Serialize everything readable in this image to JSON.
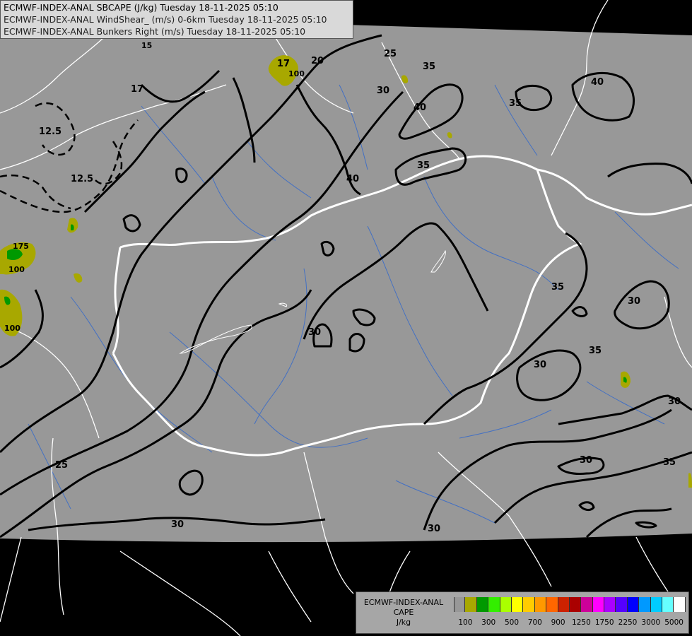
{
  "header": {
    "line1": "ECMWF-INDEX-ANAL SBCAPE (J/kg) Tuesday 18-11-2025 05:10",
    "line2": "ECMWF-INDEX-ANAL WindShear_ (m/s) 0-6km Tuesday 18-11-2025 05:10",
    "line3": "ECMWF-INDEX-ANAL Bunkers Right (m/s) Tuesday 18-11-2025 05:10"
  },
  "legend": {
    "title": "ECMWF-INDEX-ANAL",
    "variable": "CAPE",
    "unit": "J/kg",
    "colors": [
      "#989898",
      "#a8a800",
      "#009900",
      "#33ee00",
      "#aaff00",
      "#ffff00",
      "#ffcc00",
      "#ff9900",
      "#ff6600",
      "#cc2200",
      "#aa0000",
      "#cc0099",
      "#ff00ff",
      "#aa00ff",
      "#5500ff",
      "#0000ff",
      "#0099ff",
      "#00ccff",
      "#66ffff",
      "#ffffff"
    ],
    "tick_labels": [
      "100",
      "300",
      "500",
      "700",
      "900",
      "1250",
      "1750",
      "2250",
      "3000",
      "5000"
    ]
  },
  "contour_labels": [
    {
      "id": "l1",
      "text": "17"
    },
    {
      "id": "l2",
      "text": "17"
    },
    {
      "id": "l3",
      "text": "20"
    },
    {
      "id": "l4",
      "text": "25"
    },
    {
      "id": "l5",
      "text": "30"
    },
    {
      "id": "l6",
      "text": "35"
    },
    {
      "id": "l7",
      "text": "40"
    },
    {
      "id": "l8",
      "text": "40"
    },
    {
      "id": "l9",
      "text": "35"
    },
    {
      "id": "l10",
      "text": "12.5"
    },
    {
      "id": "l11",
      "text": "12.5"
    },
    {
      "id": "l12",
      "text": "40"
    },
    {
      "id": "l13",
      "text": "35"
    },
    {
      "id": "l14",
      "text": "35"
    },
    {
      "id": "l15",
      "text": "30"
    },
    {
      "id": "l16",
      "text": "30"
    },
    {
      "id": "l17",
      "text": "35"
    },
    {
      "id": "l18",
      "text": "30"
    },
    {
      "id": "l19",
      "text": "30"
    },
    {
      "id": "l20",
      "text": "30"
    },
    {
      "id": "l21",
      "text": "35"
    },
    {
      "id": "l22",
      "text": "25"
    },
    {
      "id": "l23",
      "text": "30"
    },
    {
      "id": "l24",
      "text": "30"
    },
    {
      "id": "l25",
      "text": "100"
    },
    {
      "id": "l26",
      "text": "100"
    },
    {
      "id": "l27",
      "text": "175"
    },
    {
      "id": "l28",
      "text": "100"
    },
    {
      "id": "l29",
      "text": "15"
    }
  ]
}
